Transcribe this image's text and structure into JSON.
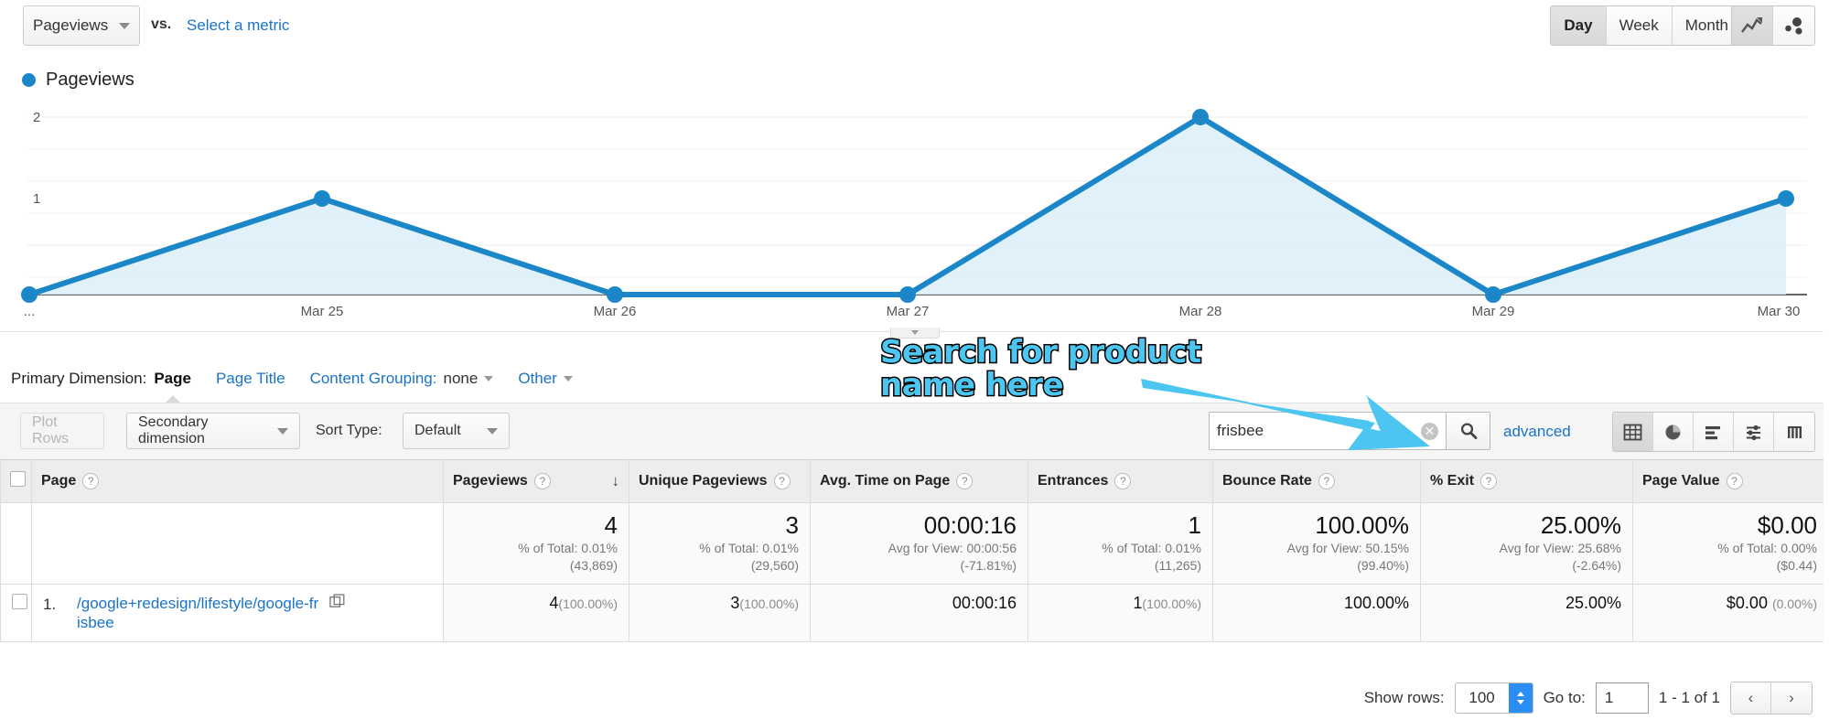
{
  "toolbar_top": {
    "metric_selected": "Pageviews",
    "vs_label": "vs.",
    "select_metric_link": "Select a metric",
    "granularity": [
      {
        "label": "Day",
        "active": true
      },
      {
        "label": "Week",
        "active": false
      },
      {
        "label": "Month",
        "active": false
      }
    ],
    "chart_type_icons": [
      {
        "name": "line-chart-icon",
        "active": true
      },
      {
        "name": "motion-chart-icon",
        "active": false
      }
    ]
  },
  "legend": {
    "label": "Pageviews",
    "color": "#1b86c8"
  },
  "chart_data": {
    "type": "area",
    "title": "Pageviews",
    "xlabel": "",
    "ylabel": "Pageviews",
    "categories": [
      "...",
      "Mar 25",
      "Mar 26",
      "Mar 27",
      "Mar 28",
      "Mar 29",
      "Mar 30"
    ],
    "values": [
      0,
      1,
      0,
      0,
      2,
      0,
      1
    ],
    "ylim": [
      0,
      2
    ],
    "yticks": [
      "1",
      "2"
    ],
    "grid": true,
    "legend_position": "top-left",
    "series": [
      {
        "name": "Pageviews",
        "color": "#1b86c8",
        "values": [
          0,
          1,
          0,
          0,
          2,
          0,
          1
        ]
      }
    ]
  },
  "primary_dimension": {
    "label": "Primary Dimension:",
    "active": "Page",
    "links": [
      "Page Title"
    ],
    "content_grouping_label": "Content Grouping:",
    "content_grouping_value": "none",
    "other_label": "Other"
  },
  "table_toolbar": {
    "plot_rows": "Plot Rows",
    "secondary_dimension": "Secondary dimension",
    "sort_type_label": "Sort Type:",
    "sort_type_value": "Default",
    "search_value": "frisbee",
    "search_placeholder": "",
    "advanced": "advanced",
    "view_icons": [
      {
        "name": "table-view-icon",
        "active": true
      },
      {
        "name": "pie-view-icon",
        "active": false
      },
      {
        "name": "bar-view-icon",
        "active": false
      },
      {
        "name": "comparison-view-icon",
        "active": false
      },
      {
        "name": "pivot-view-icon",
        "active": false
      }
    ]
  },
  "table": {
    "columns": [
      {
        "label": "Page",
        "help": "?",
        "sorted": false
      },
      {
        "label": "Pageviews",
        "help": "?",
        "sorted": true,
        "sort_dir": "desc"
      },
      {
        "label": "Unique Pageviews",
        "help": "?",
        "sorted": false
      },
      {
        "label": "Avg. Time on Page",
        "help": "?",
        "sorted": false
      },
      {
        "label": "Entrances",
        "help": "?",
        "sorted": false
      },
      {
        "label": "Bounce Rate",
        "help": "?",
        "sorted": false
      },
      {
        "label": "% Exit",
        "help": "?",
        "sorted": false
      },
      {
        "label": "Page Value",
        "help": "?",
        "sorted": false
      }
    ],
    "summary": [
      {
        "value": "4",
        "line1": "% of Total: 0.01%",
        "line2": "(43,869)"
      },
      {
        "value": "3",
        "line1": "% of Total: 0.01%",
        "line2": "(29,560)"
      },
      {
        "value": "00:00:16",
        "line1": "Avg for View: 00:00:56",
        "line2": "(-71.81%)"
      },
      {
        "value": "1",
        "line1": "% of Total: 0.01%",
        "line2": "(11,265)"
      },
      {
        "value": "100.00%",
        "line1": "Avg for View: 50.15%",
        "line2": "(99.40%)"
      },
      {
        "value": "25.00%",
        "line1": "Avg for View: 25.68%",
        "line2": "(-2.64%)"
      },
      {
        "value": "$0.00",
        "line1": "% of Total: 0.00%",
        "line2": "($0.44)"
      }
    ],
    "rows": [
      {
        "index": "1.",
        "page": "/google+redesign/lifestyle/google-frisbee",
        "pageviews": "4",
        "pageviews_pct": "(100.00%)",
        "unique_pageviews": "3",
        "unique_pageviews_pct": "(100.00%)",
        "avg_time_on_page": "00:00:16",
        "entrances": "1",
        "entrances_pct": "(100.00%)",
        "bounce_rate": "100.00%",
        "exit_pct": "25.00%",
        "page_value": "$0.00",
        "page_value_pct": "(0.00%)"
      }
    ]
  },
  "footer": {
    "show_rows_label": "Show rows:",
    "show_rows_value": "100",
    "goto_label": "Go to:",
    "goto_value": "1",
    "range_text": "1 - 1 of 1",
    "prev_icon": "‹",
    "next_icon": "›"
  },
  "annotation": {
    "text": "Search for product\nname here",
    "fill_color": "#4cc6f0",
    "stroke_color": "#000000"
  }
}
